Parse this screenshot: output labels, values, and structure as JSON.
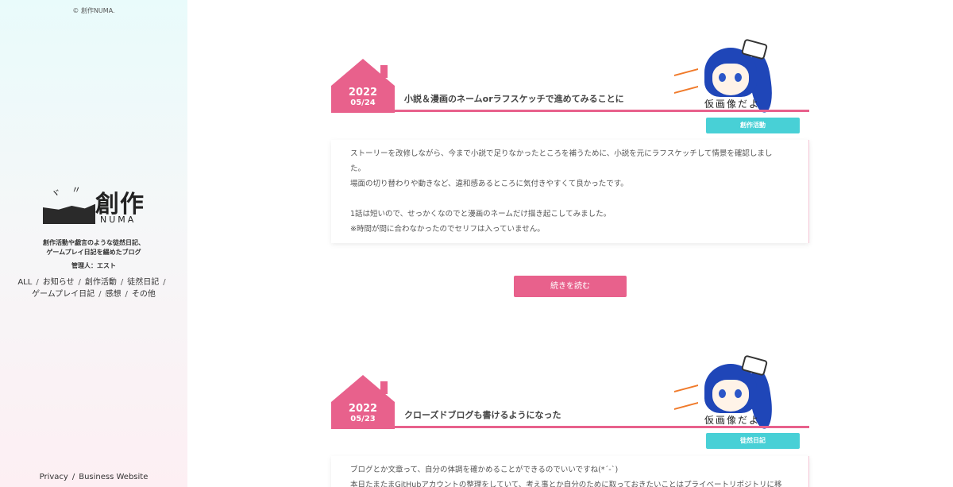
{
  "sidebar": {
    "copyright": "© 創作NUMA.",
    "logo_kanji": "創作",
    "logo_latin": "NUMA",
    "tagline_1": "創作活動や戯言のような徒然日記、",
    "tagline_2": "ゲームプレイ日記を綴めたブログ",
    "admin": "管理人：エスト",
    "categories": [
      "ALL",
      "お知らせ",
      "創作活動",
      "徒然日記",
      "ゲームプレイ日記",
      "感想",
      "その他"
    ],
    "footer": [
      "Privacy",
      "Business Website"
    ]
  },
  "posts": [
    {
      "year": "2022",
      "date": "05/24",
      "title": "小説＆漫画のネームorラフスケッチで進めてみることに",
      "tag": "創作活動",
      "image_caption": "仮画像だよ",
      "lines": [
        "ストーリーを改修しながら、今まで小説で足りなかったところを補うために、小説を元にラフスケッチして情景を確認しまし",
        "た。",
        "場面の切り替わりや動きなど、違和感あるところに気付きやすくて良かったです。",
        "",
        "1話は短いので、せっかくなのでと漫画のネームだけ描き起こしてみました。",
        "※時間が間に合わなかったのでセリフは入っていません。"
      ]
    },
    {
      "year": "2022",
      "date": "05/23",
      "title": "クローズドブログも書けるようになった",
      "tag": "徒然日記",
      "image_caption": "仮画像だよ",
      "lines": [
        "ブログとか文章って、自分の体調を確かめることができるのでいいですね(*´-`)",
        "本日たまたまGitHubアカウントの整理をしていて、考え事とか自分のために取っておきたいことはプライベートリポジトリに移"
      ]
    }
  ],
  "read_more": "続きを読む",
  "colors": {
    "accent_pink": "#e8618c",
    "tag_cyan": "#48d0d6",
    "hair_blue": "#1f46b8"
  }
}
